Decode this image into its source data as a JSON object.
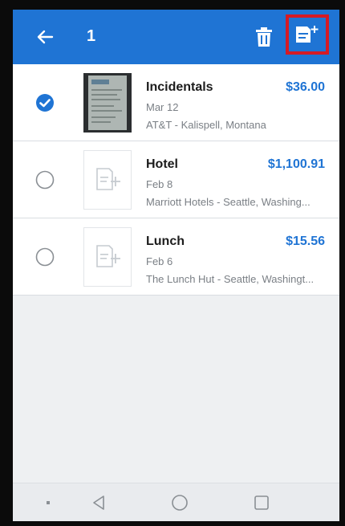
{
  "header": {
    "selected_count": "1",
    "back_icon": "arrow-left-icon",
    "delete_icon": "trash-icon",
    "add_to_report_icon": "add-to-report-icon",
    "bar_color": "#1f74d4",
    "highlight_color": "#d51a25"
  },
  "expenses": [
    {
      "title": "Incidentals",
      "amount": "$36.00",
      "date": "Mar 12",
      "merchant": "AT&T - Kalispell, Montana",
      "selected": true,
      "has_receipt": true
    },
    {
      "title": "Hotel",
      "amount": "$1,100.91",
      "date": "Feb 8",
      "merchant": "Marriott Hotels - Seattle, Washing...",
      "selected": false,
      "has_receipt": false
    },
    {
      "title": "Lunch",
      "amount": "$15.56",
      "date": "Feb 6",
      "merchant": "The Lunch Hut - Seattle, Washingt...",
      "selected": false,
      "has_receipt": false
    }
  ],
  "navbar": {
    "icons": [
      "menu-dot-icon",
      "back-triangle-icon",
      "home-circle-icon",
      "recents-square-icon"
    ]
  }
}
